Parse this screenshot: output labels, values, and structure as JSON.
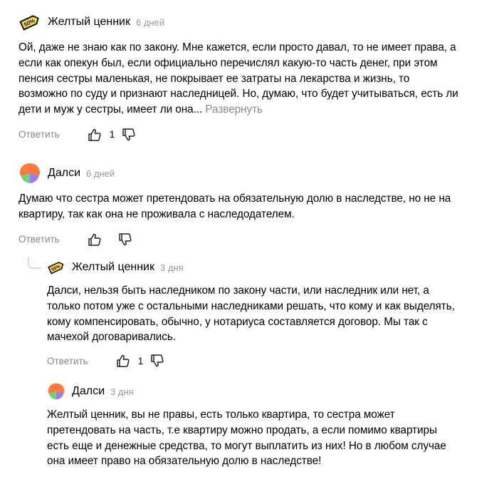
{
  "comments": [
    {
      "author": "Желтый ценник",
      "time": "6 дней",
      "text": "Ой, даже не знаю как по закону. Мне кажется, если просто давал, то не имеет права, а если как опекун был, если официально перечислял какую-то часть денег, при этом пенсия сестры маленькая, не покрывает ее затраты на лекарства и жизнь, то возможно по суду и признают наследницей. Но, думаю, что будет учитываться, есть ли дети и муж у сестры, имеет ли она...",
      "expand": "Развернуть",
      "reply": "Ответить",
      "likes": "1",
      "avatar": "yellow-tag",
      "badge": "50%"
    },
    {
      "author": "Далси",
      "time": "6 дней",
      "text": "Думаю что сестра может претендовать на обязательную долю в наследстве, но не на квартиру, так как она не проживала с наследодателем.",
      "reply": "Ответить",
      "likes": "",
      "avatar": "petal-orange-violet-green"
    },
    {
      "author": "Желтый ценник",
      "time": "3 дня",
      "text": "Далси, нельзя быть наследником по закону части, или наследник или нет, а только потом уже с остальными наследниками решать, что кому и как выделять, кому компенсировать, обычно, у нотариуса составляется договор. Мы так с мачехой договаривались.",
      "reply": "Ответить",
      "likes": "1",
      "avatar": "yellow-tag",
      "badge": "50%"
    },
    {
      "author": "Далси",
      "time": "3 дня",
      "text": "Желтый ценник, вы не правы, есть только квартира, то сестра может претендовать на часть, т.е квартиру можно продать, а если помимо квартиры есть еще и денежные средства, то могут выплатить из них! Но в любом случае она имеет право на обязательную долю в наследстве!",
      "avatar": "petal-orange-violet-green"
    }
  ],
  "colors": {
    "text": "#000000",
    "muted": "#999999",
    "link": "#8a8a8a",
    "tag_yellow": "#ffdb4d",
    "petal_orange": "#ff7a3d",
    "petal_violet": "#9b7bff",
    "petal_green": "#6fd37a"
  }
}
